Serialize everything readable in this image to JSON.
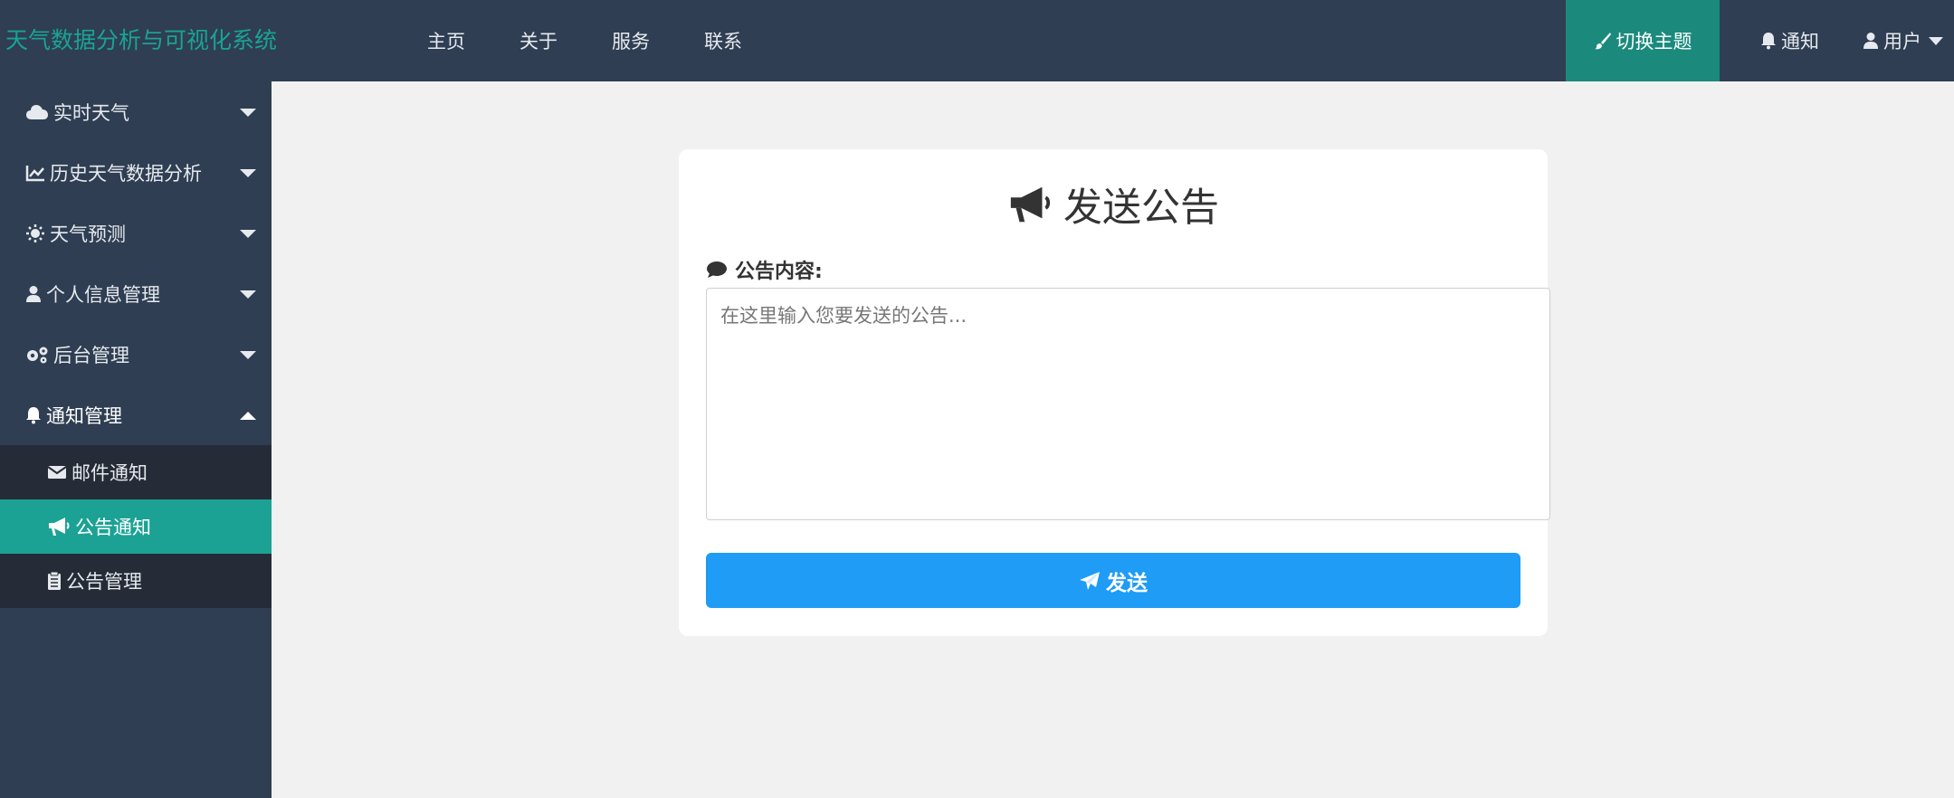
{
  "header": {
    "brand": "天气数据分析与可视化系统",
    "nav": [
      "主页",
      "关于",
      "服务",
      "联系"
    ],
    "theme_button": "切换主题",
    "notify": "通知",
    "user": "用户"
  },
  "sidebar": {
    "items": [
      {
        "label": "实时天气",
        "icon": "cloud-icon"
      },
      {
        "label": "历史天气数据分析",
        "icon": "line-chart-icon"
      },
      {
        "label": "天气预测",
        "icon": "sun-icon"
      },
      {
        "label": "个人信息管理",
        "icon": "user-icon"
      },
      {
        "label": "后台管理",
        "icon": "gears-icon"
      },
      {
        "label": "通知管理",
        "icon": "bell-icon"
      }
    ],
    "submenu": [
      {
        "label": "邮件通知",
        "icon": "envelope-icon"
      },
      {
        "label": "公告通知",
        "icon": "bullhorn-icon",
        "active": true
      },
      {
        "label": "公告管理",
        "icon": "clipboard-icon"
      }
    ]
  },
  "card": {
    "title": "发送公告",
    "field_label": "公告内容:",
    "placeholder": "在这里输入您要发送的公告...",
    "send_label": "发送"
  },
  "colors": {
    "nav_bg": "#2f3e52",
    "brand": "#1aa394",
    "theme_button": "#1b8a7c",
    "active_item": "#1ba294",
    "submenu_bg": "#262c37",
    "send_button": "#1e9cf6",
    "page_bg": "#f1f1f1"
  }
}
